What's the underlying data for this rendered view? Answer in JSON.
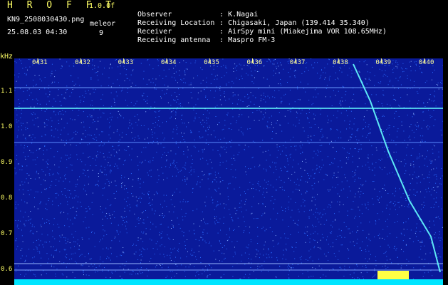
{
  "header": {
    "title": "H R O F F T",
    "version": "1.0.0f",
    "filename": "KN9_2508030430.png",
    "timestamp": "25.08.03 04:30",
    "meteor_label": "meleor",
    "meteor_count": "9"
  },
  "meta": [
    {
      "key": "Observer",
      "value": ": K.Nagai"
    },
    {
      "key": "Receiving Location",
      "value": ": Chigasaki, Japan (139.414 35.340)"
    },
    {
      "key": "Receiver",
      "value": ": AirSpy mini (Miakejima VOR 108.65MHz)"
    },
    {
      "key": "Receiving antenna",
      "value": ": Maspro FM-3"
    }
  ],
  "axis": {
    "unit": "kHz",
    "y_ticks": [
      "1.1",
      "1.0",
      "0.9",
      "0.8",
      "0.7",
      "0.6"
    ],
    "x_ticks": [
      "0431",
      "0432",
      "0433",
      "0434",
      "0435",
      "0436",
      "0437",
      "0438",
      "0439",
      "0440"
    ]
  },
  "colors": {
    "background": "#0a1a9a",
    "noise": "#2a6aff",
    "signal": "#66ffff",
    "label_yellow": "#ffff66"
  }
}
